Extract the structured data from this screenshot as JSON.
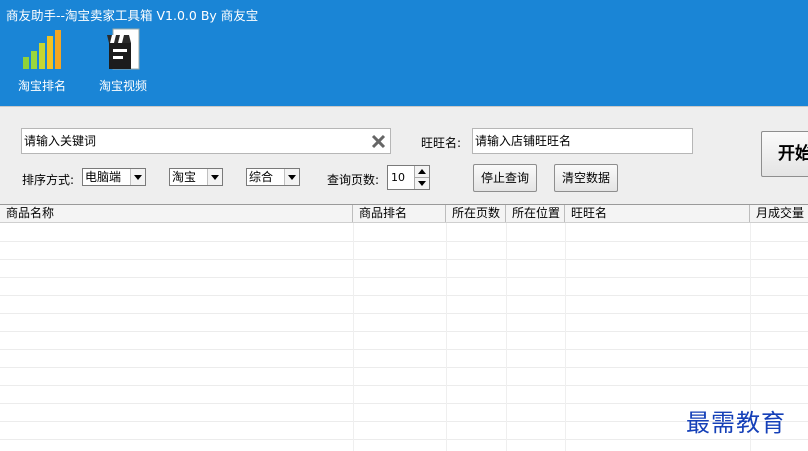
{
  "app": {
    "title": "商友助手--淘宝卖家工具箱 V1.0.0 By 商友宝",
    "accent": "#1a85d6"
  },
  "toolbar": {
    "items": [
      {
        "label": "淘宝排名",
        "icon": "bar-chart-icon"
      },
      {
        "label": "淘宝视频",
        "icon": "clapperboard-icon"
      }
    ]
  },
  "search": {
    "keyword_placeholder": "请输入关键词",
    "wangwang_label": "旺旺名:",
    "wangwang_placeholder": "请输入店铺旺旺名",
    "start_button": "开始"
  },
  "options": {
    "sort_label": "排序方式:",
    "platform": "电脑端",
    "site": "淘宝",
    "order": "综合",
    "pages_label": "查询页数:",
    "pages_value": "10",
    "stop_button": "停止查询",
    "clear_button": "清空数据"
  },
  "table": {
    "columns": [
      "商品名称",
      "商品排名",
      "所在页数",
      "所在位置",
      "旺旺名",
      "月成交量"
    ]
  },
  "watermark": "最需教育"
}
